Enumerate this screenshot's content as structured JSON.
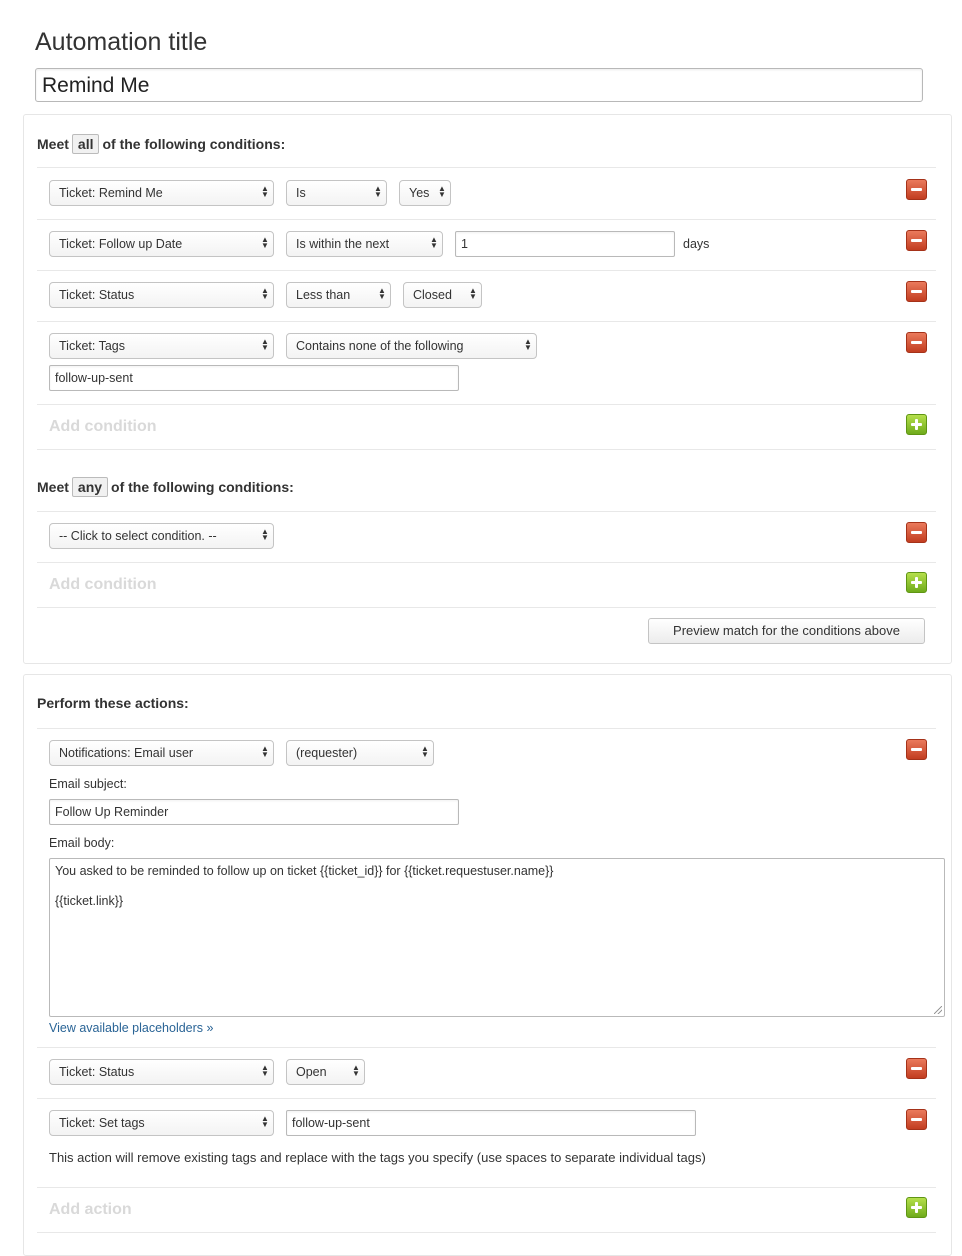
{
  "header": {
    "title_label": "Automation title",
    "title_value": "Remind Me"
  },
  "conditions_all": {
    "heading_prefix": "Meet",
    "heading_pill": "all",
    "heading_suffix": "of the following conditions:",
    "rows": [
      {
        "field": "Ticket: Remind Me",
        "operator": "Is",
        "value": "Yes"
      },
      {
        "field": "Ticket: Follow up Date",
        "operator": "Is within the next",
        "value": "1",
        "unit": "days"
      },
      {
        "field": "Ticket: Status",
        "operator": "Less than",
        "value": "Closed"
      },
      {
        "field": "Ticket: Tags",
        "operator": "Contains none of the following",
        "value": "follow-up-sent"
      }
    ],
    "add_label": "Add condition"
  },
  "conditions_any": {
    "heading_prefix": "Meet",
    "heading_pill": "any",
    "heading_suffix": "of the following conditions:",
    "rows": [
      {
        "field": "-- Click to select condition. --"
      }
    ],
    "add_label": "Add condition"
  },
  "preview_button": "Preview match for the conditions above",
  "actions": {
    "heading": "Perform these actions:",
    "email": {
      "field": "Notifications: Email user",
      "target": "(requester)",
      "subject_label": "Email subject:",
      "subject_value": "Follow Up Reminder",
      "body_label": "Email body:",
      "body_value": "You asked to be reminded to follow up on ticket {{ticket_id}} for {{ticket.requestuser.name}}\n\n{{ticket.link}}",
      "placeholders_link": "View available placeholders »"
    },
    "status": {
      "field": "Ticket: Status",
      "value": "Open"
    },
    "tags": {
      "field": "Ticket: Set tags",
      "value": "follow-up-sent",
      "help": "This action will remove existing tags and replace with the tags you specify (use spaces to separate individual tags)"
    },
    "add_label": "Add action"
  },
  "colors": {
    "remove_button": "#d9532f",
    "add_button": "#8cc63f",
    "link": "#2a6496"
  },
  "icons": {
    "remove": "minus-icon",
    "add": "plus-icon",
    "select_arrow": "updown-arrow-icon"
  }
}
